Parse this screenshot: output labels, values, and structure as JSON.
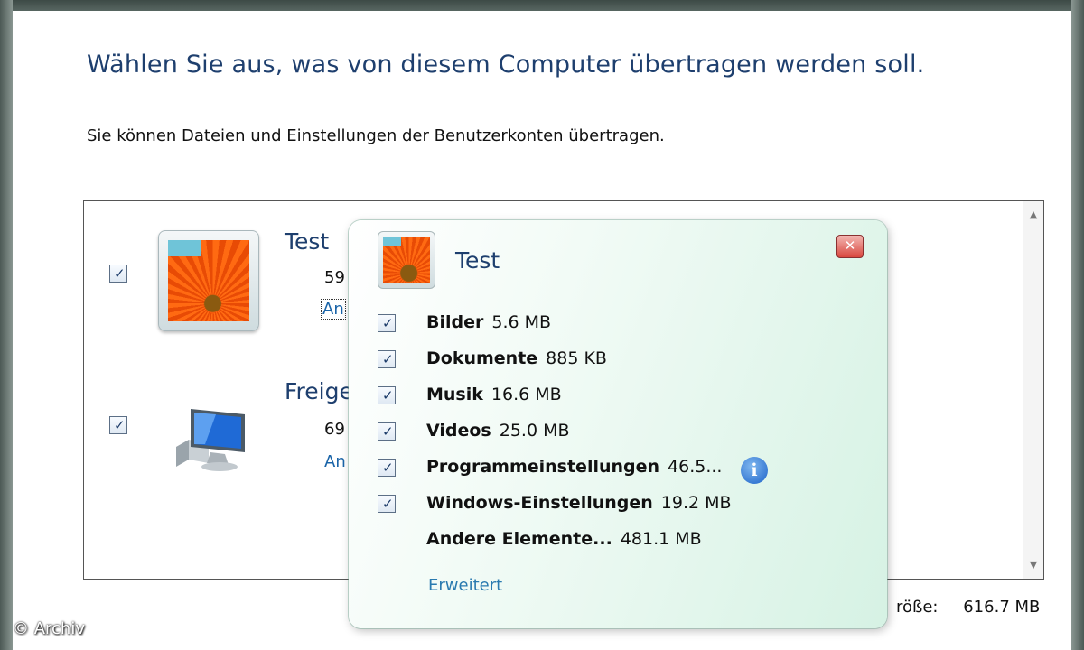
{
  "heading": "Wählen Sie aus, was von diesem Computer übertragen werden soll.",
  "subtext": "Sie können Dateien und Einstellungen der Benutzerkonten übertragen.",
  "accounts": [
    {
      "name": "Test",
      "size": "59",
      "link": "An",
      "checked": true,
      "icon": "user-avatar-flower"
    },
    {
      "name": "Freige",
      "size": "69",
      "link": "An",
      "checked": true,
      "icon": "shared-computer-icon"
    }
  ],
  "popup": {
    "name": "Test",
    "close_icon": "close-icon",
    "items": [
      {
        "label": "Bilder",
        "size": "5.6 MB",
        "checked": true
      },
      {
        "label": "Dokumente",
        "size": "885 KB",
        "checked": true
      },
      {
        "label": "Musik",
        "size": "16.6 MB",
        "checked": true
      },
      {
        "label": "Videos",
        "size": "25.0 MB",
        "checked": true
      },
      {
        "label": "Programmeinstellungen",
        "size": "46.5...",
        "checked": true
      },
      {
        "label": "Windows-Einstellungen",
        "size": "19.2 MB",
        "checked": true
      },
      {
        "label": "Andere Elemente...",
        "size": "481.1 MB",
        "checked": false
      }
    ],
    "info_icon": "info-icon",
    "advanced_link": "Erweitert"
  },
  "total": {
    "label": "röße:",
    "value": "616.7 MB"
  },
  "watermark": "© Archiv",
  "colors": {
    "heading": "#1e3f6e",
    "link": "#1a64a8",
    "popup_bg": "#d6f2e4"
  }
}
